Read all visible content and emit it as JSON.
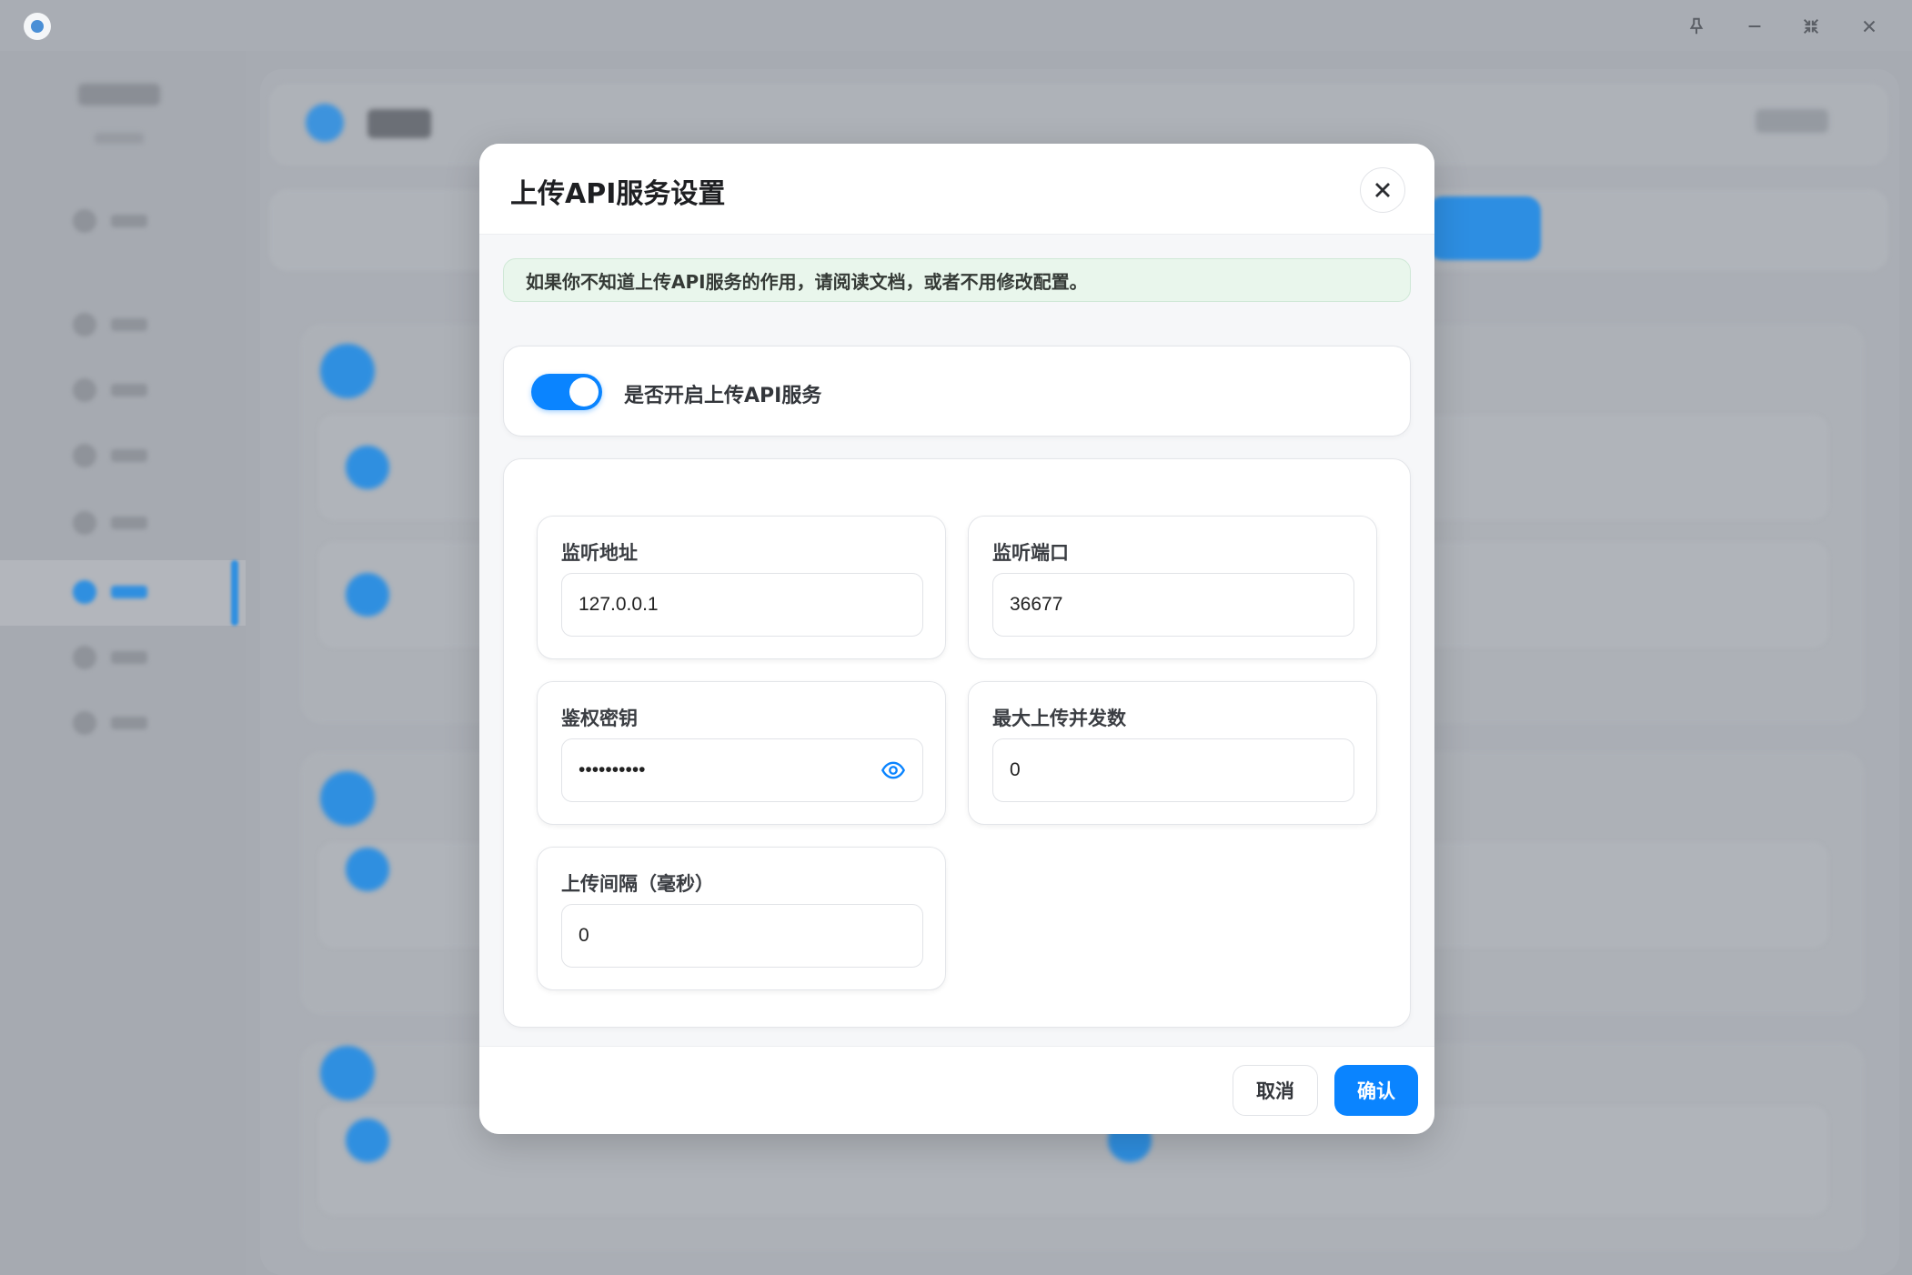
{
  "modal": {
    "title": "上传API服务设置",
    "notice": "如果你不知道上传API服务的作用，请阅读文档，或者不用修改配置。",
    "toggle_label": "是否开启上传API服务",
    "toggle_on": true,
    "fields": {
      "listen_address": {
        "label": "监听地址",
        "value": "127.0.0.1"
      },
      "listen_port": {
        "label": "监听端口",
        "value": "36677"
      },
      "auth_key": {
        "label": "鉴权密钥",
        "value": "••••••••••"
      },
      "max_concurrency": {
        "label": "最大上传并发数",
        "value": "0"
      },
      "upload_interval": {
        "label": "上传间隔（毫秒）",
        "value": "0"
      }
    },
    "cancel_label": "取消",
    "confirm_label": "确认"
  },
  "colors": {
    "accent": "#0a84ff",
    "notice_bg": "#e9f6ec"
  },
  "icons": [
    "close-icon",
    "eye-icon",
    "pin-icon",
    "minimize-icon",
    "restore-icon",
    "window-close-icon"
  ]
}
